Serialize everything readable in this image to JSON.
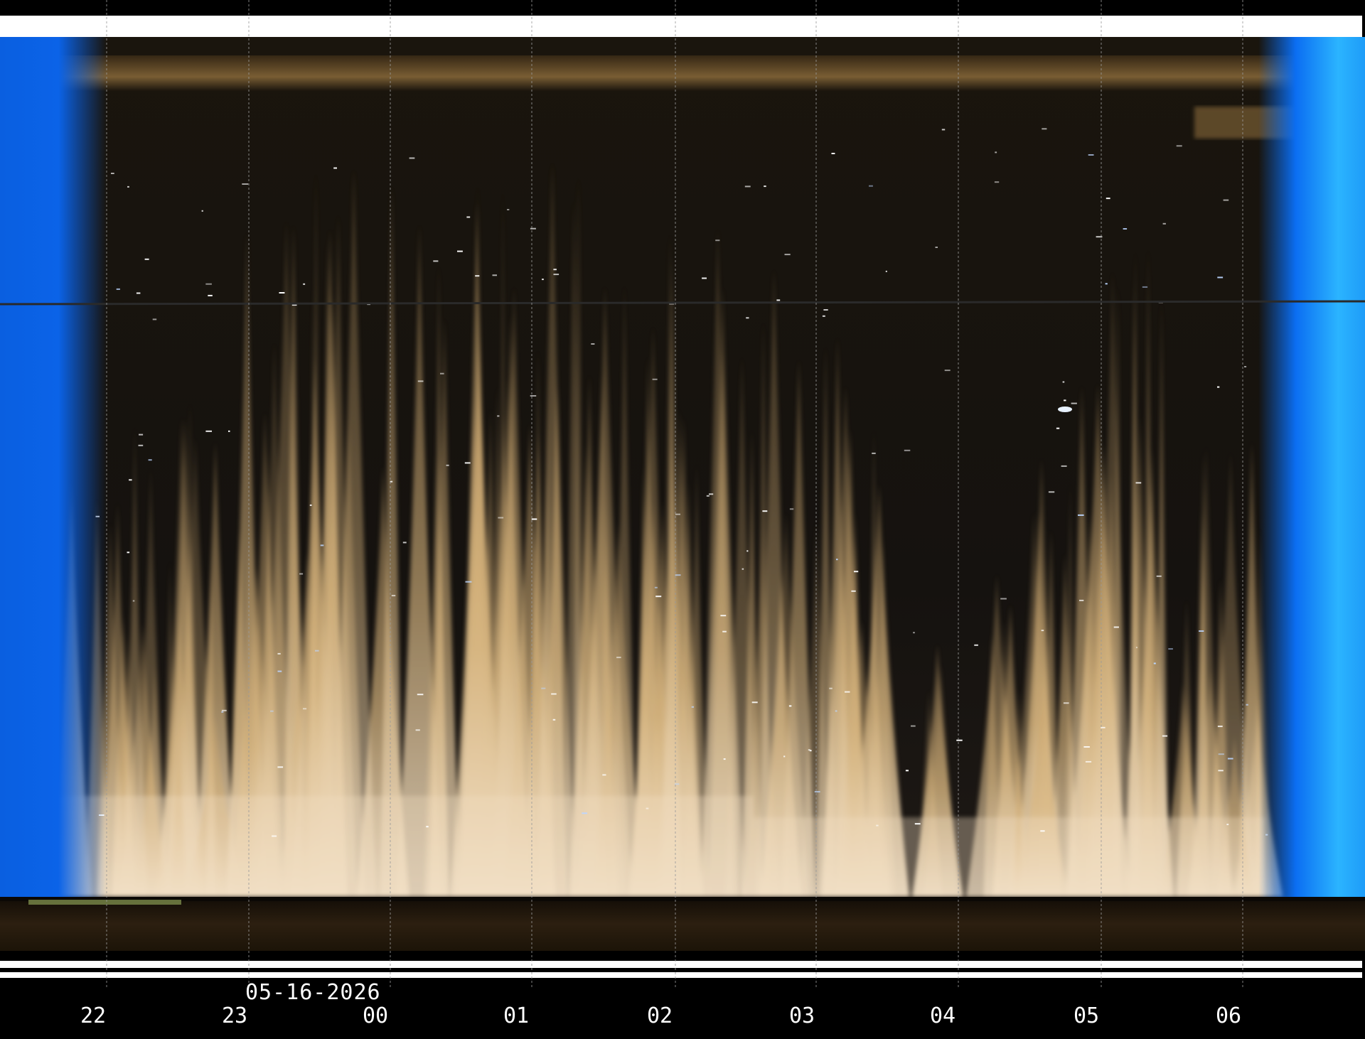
{
  "image": {
    "kind": "keogram",
    "date_label": "05-16-2026",
    "hour_labels": [
      "22",
      "23",
      "00",
      "01",
      "02",
      "03",
      "04",
      "05",
      "06"
    ],
    "colors": {
      "twilight_blue": "#0a6cf0",
      "twilight_cyan": "#27b8ff",
      "cloud_tan": "#d8b784",
      "cloud_light": "#f0dcc0",
      "night_sky": "#15130f",
      "ground_band": "#2a1e10",
      "grid": "#9a9a9a"
    }
  }
}
